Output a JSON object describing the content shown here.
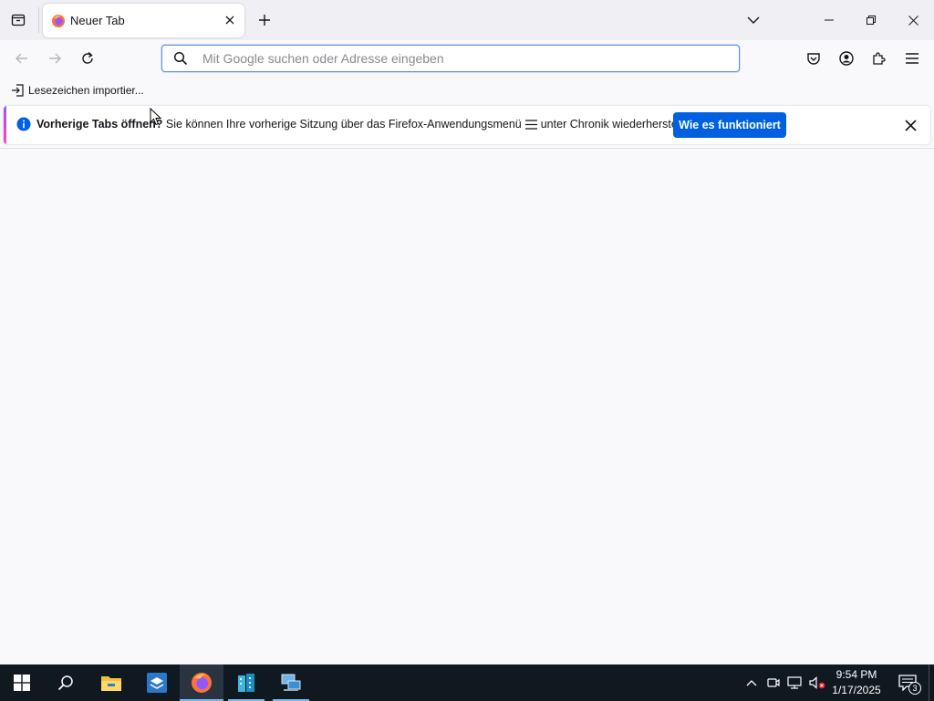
{
  "window": {
    "tab_title": "Neuer Tab",
    "tab_favicon_icon": "firefox-icon"
  },
  "navbar": {
    "url_placeholder": "Mit Google suchen oder Adresse eingeben",
    "url_value": ""
  },
  "bookmarks": {
    "import_label": "Lesezeichen importier..."
  },
  "notification": {
    "bold_text": "Vorherige Tabs öffnen?",
    "text_before_menu": " Sie können Ihre vorherige Sitzung über das Firefox-Anwendungsmenü",
    "text_after_menu": "unter Chronik wiederherstellen.",
    "button_label": "Wie es funktioniert"
  },
  "taskbar": {
    "time": "9:54 PM",
    "date": "1/17/2025",
    "notification_count": "3",
    "apps": [
      "start-icon",
      "search-icon",
      "file-explorer-icon",
      "app-icon",
      "firefox-icon",
      "buildings-app-icon",
      "network-app-icon"
    ]
  },
  "colors": {
    "accent_blue": "#0061e0",
    "urlbar_border": "#5b91d8",
    "taskbar_bg": "#101820"
  }
}
